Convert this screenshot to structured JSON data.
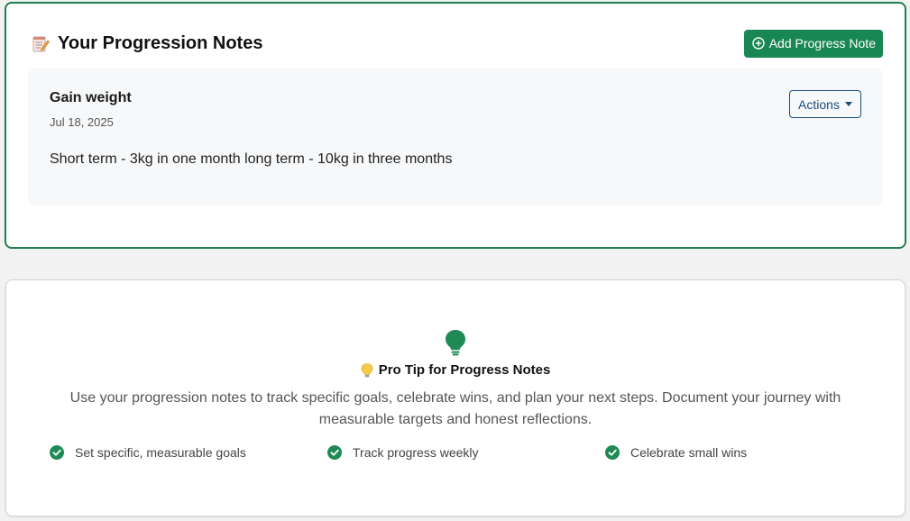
{
  "notes_section": {
    "title": "Your Progression Notes",
    "add_button_label": "Add Progress Note",
    "notes": [
      {
        "title": "Gain weight",
        "date": "Jul 18, 2025",
        "body": "Short term - 3kg in one month long term - 10kg in three months",
        "actions_label": "Actions"
      }
    ]
  },
  "tip_section": {
    "title": "Pro Tip for Progress Notes",
    "text": "Use your progression notes to track specific goals, celebrate wins, and plan your next steps. Document your journey with measurable targets and honest reflections.",
    "items": [
      "Set specific, measurable goals",
      "Track progress weekly",
      "Celebrate small wins"
    ]
  },
  "colors": {
    "accent_green": "#198754",
    "outline_blue": "#1c4d7a"
  },
  "icons": [
    "memo-icon",
    "plus-circle-icon",
    "caret-down-icon",
    "lightbulb-icon",
    "check-circle-icon"
  ]
}
